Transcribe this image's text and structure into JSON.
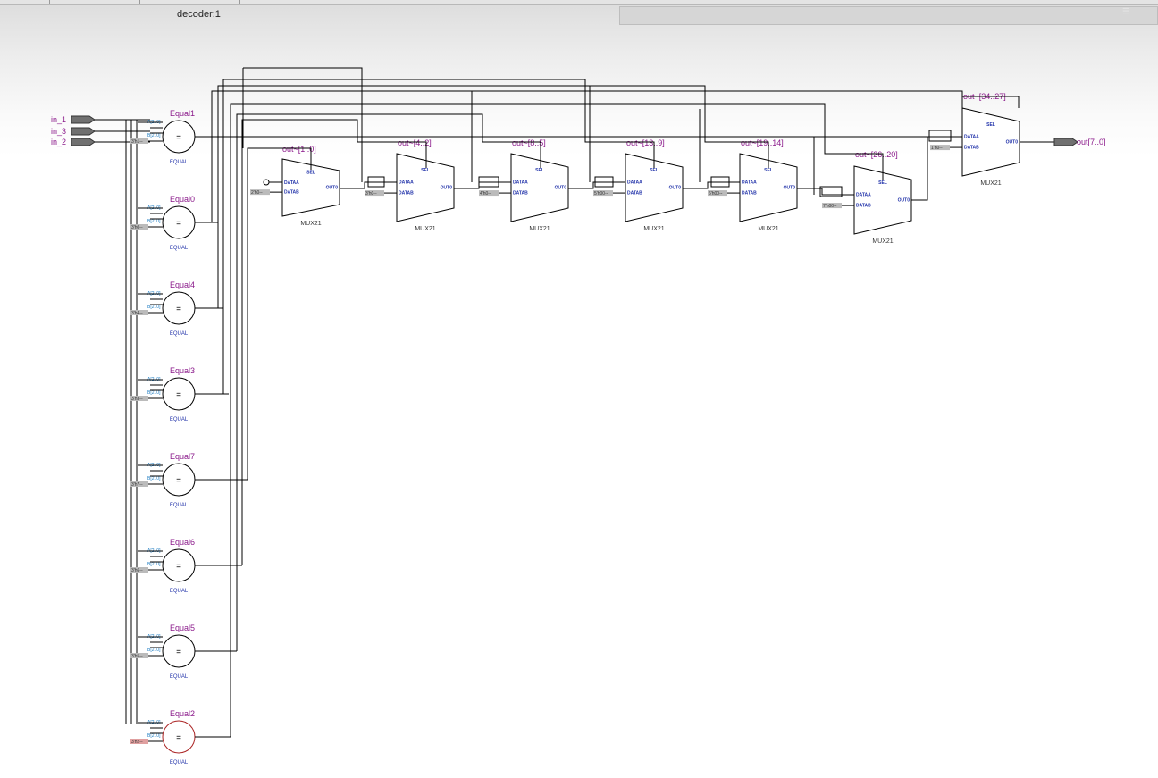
{
  "tab": {
    "title": "decoder:1"
  },
  "inputs": [
    "in_1",
    "in_3",
    "in_2"
  ],
  "output": {
    "label": "out[7..0]"
  },
  "comparators": [
    {
      "name": "Equal1",
      "symbol": "=",
      "type": "EQUAL",
      "port_a": "A[2..0]",
      "port_b": "B[2..0]",
      "const": "3'h1--"
    },
    {
      "name": "Equal0",
      "symbol": "=",
      "type": "EQUAL",
      "port_a": "A[2..0]",
      "port_b": "B[2..0]",
      "const": "3'h0--"
    },
    {
      "name": "Equal4",
      "symbol": "=",
      "type": "EQUAL",
      "port_a": "A[2..0]",
      "port_b": "B[2..0]",
      "const": "3'h4--"
    },
    {
      "name": "Equal3",
      "symbol": "=",
      "type": "EQUAL",
      "port_a": "A[2..0]",
      "port_b": "B[2..0]",
      "const": "3'h3--"
    },
    {
      "name": "Equal7",
      "symbol": "=",
      "type": "EQUAL",
      "port_a": "A[2..0]",
      "port_b": "B[2..0]",
      "const": "3'h7--"
    },
    {
      "name": "Equal6",
      "symbol": "=",
      "type": "EQUAL",
      "port_a": "A[2..0]",
      "port_b": "B[2..0]",
      "const": "3'h6--"
    },
    {
      "name": "Equal5",
      "symbol": "=",
      "type": "EQUAL",
      "port_a": "A[2..0]",
      "port_b": "B[2..0]",
      "const": "3'h5--"
    },
    {
      "name": "Equal2",
      "symbol": "=",
      "type": "EQUAL",
      "port_a": "A[2..0]",
      "port_b": "B[2..0]",
      "const": "3'h2--",
      "highlighted": true
    }
  ],
  "muxes": [
    {
      "name": "out~[1..0]",
      "type": "MUX21",
      "sel": "SEL",
      "in_a": "DATAA",
      "in_b": "DATAB",
      "out": "OUT0",
      "const": "2'h0--"
    },
    {
      "name": "out~[4..2]",
      "type": "MUX21",
      "sel": "SEL",
      "in_a": "DATAA",
      "in_b": "DATAB",
      "out": "OUT0",
      "const": "3'h0--"
    },
    {
      "name": "out~[8..5]",
      "type": "MUX21",
      "sel": "SEL",
      "in_a": "DATAA",
      "in_b": "DATAB",
      "out": "OUT0",
      "const": "4'h0--"
    },
    {
      "name": "out~[13..9]",
      "type": "MUX21",
      "sel": "SEL",
      "in_a": "DATAA",
      "in_b": "DATAB",
      "out": "OUT0",
      "const": "5'h00--"
    },
    {
      "name": "out~[19..14]",
      "type": "MUX21",
      "sel": "SEL",
      "in_a": "DATAA",
      "in_b": "DATAB",
      "out": "OUT0",
      "const": "6'h00--"
    },
    {
      "name": "out~[26..20]",
      "type": "MUX21",
      "sel": "SEL",
      "in_a": "DATAA",
      "in_b": "DATAB",
      "out": "OUT0",
      "const": "7'h00--"
    },
    {
      "name": "out~[34..27]",
      "type": "MUX21",
      "sel": "SEL",
      "in_a": "DATAA",
      "in_b": "DATAB",
      "out": "OUT0",
      "const": "1'h0--"
    }
  ],
  "colors": {
    "wire": "#000000",
    "instance_label": "#8b1a8b",
    "type_label": "#2233aa",
    "bus_label": "#1a7ac0",
    "highlight": "#aa2222",
    "pin_fill": "#707070"
  }
}
